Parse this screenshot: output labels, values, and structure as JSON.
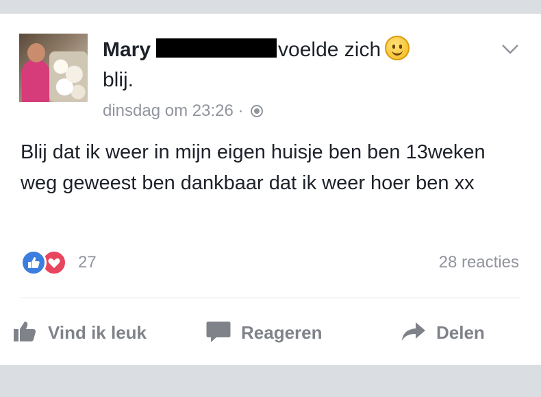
{
  "post": {
    "author_name": "Mary",
    "feeling_text": "voelde zich",
    "feeling_suffix": "blij.",
    "timestamp": "dinsdag om 23:26 ·",
    "privacy_icon": "globe-icon",
    "body": "Blij dat ik weer in mijn eigen huisje ben ben 13weken weg geweest ben dankbaar dat ik weer hoer ben xx"
  },
  "reactions": {
    "count": "27",
    "types": [
      "like",
      "love"
    ],
    "comments_label": "28 reacties"
  },
  "actions": {
    "like_label": "Vind ik leuk",
    "comment_label": "Reageren",
    "share_label": "Delen"
  },
  "colors": {
    "like_blue": "#3b7ee0",
    "love_red": "#e8465e",
    "muted_text": "#90949c",
    "body_text": "#1d2129"
  }
}
